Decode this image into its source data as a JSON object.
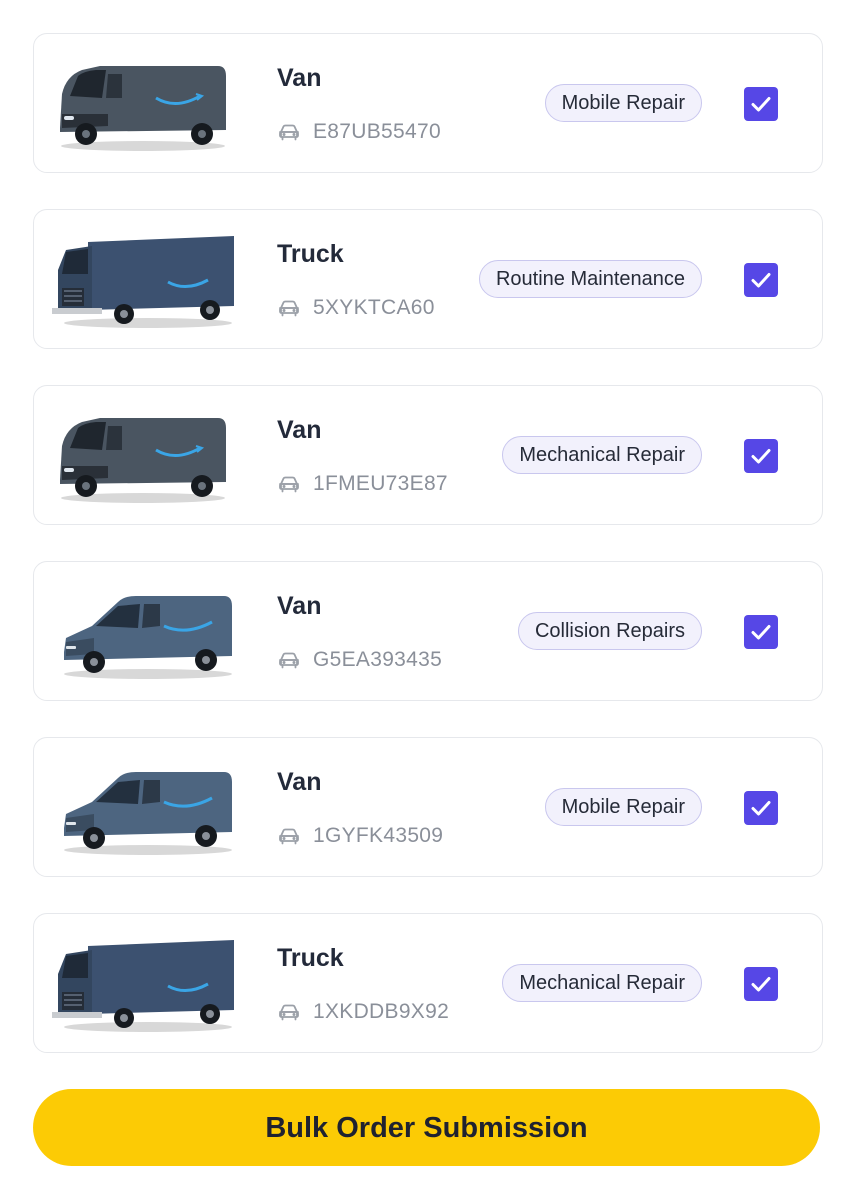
{
  "vehicles": [
    {
      "type": "Van",
      "plate": "E87UB55470",
      "service": "Mobile Repair",
      "image": "electric-van",
      "checked": true
    },
    {
      "type": "Truck",
      "plate": "5XYKTCA60",
      "service": "Routine Maintenance",
      "image": "step-truck",
      "checked": true
    },
    {
      "type": "Van",
      "plate": "1FMEU73E87",
      "service": "Mechanical Repair",
      "image": "electric-van",
      "checked": true
    },
    {
      "type": "Van",
      "plate": "G5EA393435",
      "service": "Collision Repairs",
      "image": "sprinter-van",
      "checked": true
    },
    {
      "type": "Van",
      "plate": "1GYFK43509",
      "service": "Mobile Repair",
      "image": "sprinter-van",
      "checked": true
    },
    {
      "type": "Truck",
      "plate": "1XKDDB9X92",
      "service": "Mechanical Repair",
      "image": "step-truck",
      "checked": true
    }
  ],
  "icons": {
    "plate": "car-icon",
    "check": "checkmark-icon"
  },
  "colors": {
    "accent": "#5647e6",
    "button": "#fccb05",
    "tag_bg": "#f2f1fc",
    "tag_border": "#c9c7ee"
  },
  "actions": {
    "submit_label": "Bulk Order Submission"
  }
}
